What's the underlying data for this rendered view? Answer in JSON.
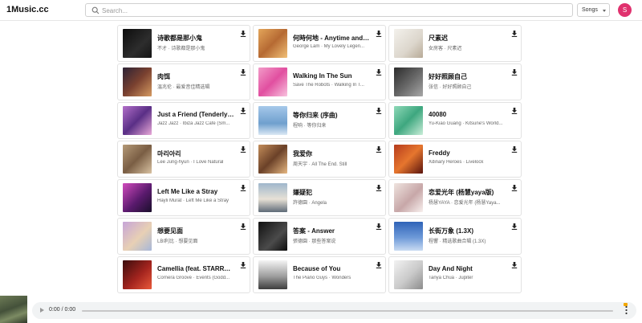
{
  "header": {
    "brand": "1Music.cc",
    "search_placeholder": "Search...",
    "search_value": "",
    "type_select": "Songs",
    "avatar_letter": "S",
    "accent_color": "#e0316e"
  },
  "songs": [
    {
      "title": "诗歌都是那小鬼",
      "subtitle": "不才 · 诗歌都是那小鬼",
      "cover": "linear-gradient(135deg,#0c0c0c 0%,#2d2d2d 60%,#151515 100%)",
      "download_icon": "download-icon"
    },
    {
      "title": "何時何地 - Anytime and A...",
      "subtitle": "George Lam · My Lovely Legen...",
      "cover": "linear-gradient(135deg,#e3a55a 0%,#b66a33 50%,#f1c077 100%)",
      "download_icon": "download-icon"
    },
    {
      "title": "尺素迟",
      "subtitle": "女房客 · 尺素迟",
      "cover": "linear-gradient(135deg,#f3f1ec 0%,#dcd6cc 60%,#b7aa97 100%)",
      "download_icon": "download-icon"
    },
    {
      "title": "肉饵",
      "subtitle": "温兆伦 · 最爱音佳精选辑",
      "cover": "linear-gradient(135deg,#2c2235 0%,#7a4130 50%,#d59a61 100%)",
      "download_icon": "download-icon"
    },
    {
      "title": "Walking In The Sun",
      "subtitle": "Save The Robots · Walking In T...",
      "cover": "linear-gradient(135deg,#f29bc8 0%,#e14fa0 50%,#f8c3df 100%)",
      "download_icon": "download-icon"
    },
    {
      "title": "好好照顾自己",
      "subtitle": "张信 · 好好照顾自己",
      "cover": "linear-gradient(135deg,#2b2b2b 0%,#6b6b6b 55%,#a8a8a8 100%)",
      "download_icon": "download-icon"
    },
    {
      "title": "Just a Friend (Tenderly Mix)",
      "subtitle": "Jazz Jazz · Ibiza Jazz Cafe (Sm...",
      "cover": "linear-gradient(135deg,#b26fc9 0%,#5a2f86 50%,#e9a9d8 100%)",
      "download_icon": "download-icon"
    },
    {
      "title": "等你归来 (序曲)",
      "subtitle": "程响 · 等你归来",
      "cover": "linear-gradient(180deg,#a6c9ea 0%,#6f9fce 60%,#dbe8f4 100%)",
      "download_icon": "download-icon"
    },
    {
      "title": "40080",
      "subtitle": "Yu-Kiao Guang · Kitsune's World...",
      "cover": "linear-gradient(135deg,#8fd9b8 0%,#3ea77f 50%,#c9eed8 100%)",
      "download_icon": "download-icon"
    },
    {
      "title": "마리아리",
      "subtitle": "Lee Jung-hyun · I Love Natural",
      "cover": "linear-gradient(135deg,#b59a78 0%,#7a5e44 50%,#d9c2a2 100%)",
      "download_icon": "download-icon"
    },
    {
      "title": "我爱你",
      "subtitle": "周天宇 · All The End. Still",
      "cover": "linear-gradient(135deg,#c38d5a 0%,#6b4128 50%,#e6b781 100%)",
      "download_icon": "download-icon"
    },
    {
      "title": "Freddy",
      "subtitle": "Xdinary Heroes · Livelock",
      "cover": "linear-gradient(135deg,#b53b1d 0%,#e6762e 50%,#5a140d 100%)",
      "download_icon": "download-icon"
    },
    {
      "title": "Left Me Like a Stray",
      "subtitle": "Hayli Murat · Left Me Like a Stray",
      "cover": "linear-gradient(135deg,#d14bbd 0%,#5a1a6e 55%,#1b0f2b 100%)",
      "download_icon": "download-icon"
    },
    {
      "title": "嫌疑犯",
      "subtitle": "許德園 · Angela",
      "cover": "linear-gradient(180deg,#9fb7cc 0%,#e7e1d6 55%,#5f6b78 100%)",
      "download_icon": "download-icon"
    },
    {
      "title": "恋爱光年 (杨慧yaya版)",
      "subtitle": "杨慧YAYA · 恋爱光年 (杨慧Yaya...",
      "cover": "linear-gradient(135deg,#efe4df 0%,#c7a7a8 55%,#f8f0ee 100%)",
      "download_icon": "download-icon"
    },
    {
      "title": "想要见面",
      "subtitle": "LBI利比 · 想要见面",
      "cover": "linear-gradient(135deg,#c6a4d8 0%,#e8d0b4 55%,#a7b7d9 100%)",
      "download_icon": "download-icon"
    },
    {
      "title": "答案 - Answer",
      "subtitle": "張德園 · 那些答案说",
      "cover": "linear-gradient(135deg,#111111 0%,#4b4b4b 60%,#0d0d0d 100%)",
      "download_icon": "download-icon"
    },
    {
      "title": "长街万象 (1.3X)",
      "subtitle": "程響 · 精选歌曲合辑 (1.3X)",
      "cover": "linear-gradient(180deg,#2f63b8 0%,#6e9ad8 55%,#c9dbf2 100%)",
      "download_icon": "download-icon"
    },
    {
      "title": "Camellia (feat. STARRYS...",
      "subtitle": "Cornera Groove · Events (Godd...",
      "cover": "linear-gradient(135deg,#3a0d0d 0%,#a3241e 55%,#e9593a 100%)",
      "download_icon": "download-icon"
    },
    {
      "title": "Because of You",
      "subtitle": "The Piano Guys · Wonders",
      "cover": "linear-gradient(180deg,#f4f4f4 0%,#9e9e9e 55%,#3d3d3d 100%)",
      "download_icon": "download-icon"
    },
    {
      "title": "Day And Night",
      "subtitle": "Tanya Chua · Jupiter",
      "cover": "linear-gradient(135deg,#f2f2f2 0%,#c9c9c9 55%,#8c8c8c 100%)",
      "download_icon": "download-icon"
    }
  ],
  "player": {
    "current_time": "0:00",
    "separator": "/",
    "duration": "0:00",
    "progress": 0,
    "play_icon": "play-icon",
    "more_icon": "more-vertical-icon",
    "thumbnail_icon": "album-thumbnail"
  }
}
